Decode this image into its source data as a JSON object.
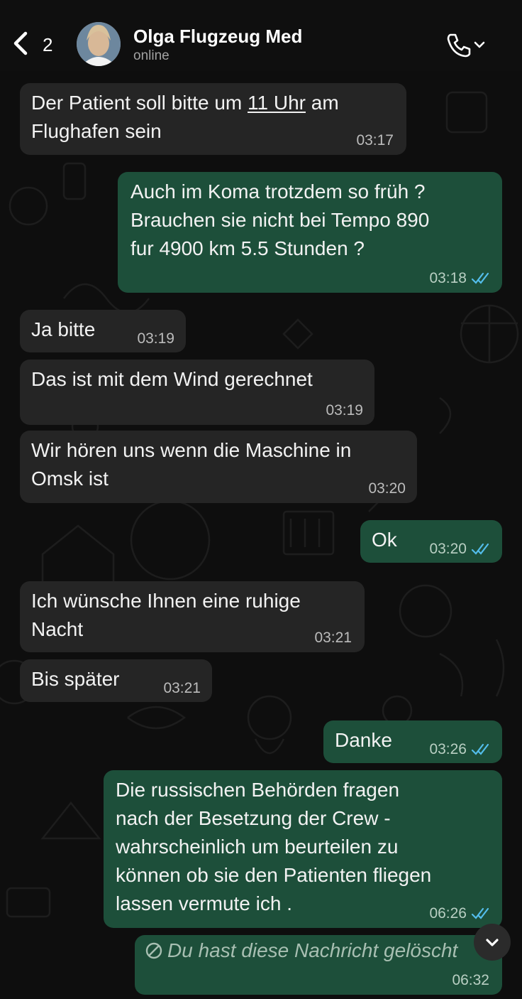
{
  "header": {
    "back_count": "2",
    "contact_name": "Olga Flugzeug Med",
    "status": "online"
  },
  "colors": {
    "incoming_bubble": "#252525",
    "outgoing_bubble": "#1d4f3a",
    "read_ticks": "#53bdeb"
  },
  "icons": {
    "back": "chevron-left-icon",
    "call": "phone-icon",
    "call_menu": "chevron-down-icon",
    "read": "double-check-icon",
    "deleted": "ban-icon",
    "scroll": "chevron-down-icon"
  },
  "messages": [
    {
      "direction": "in",
      "lines": [
        "Der Patient soll bitte um ",
        "11 Uhr",
        " am",
        "Flughafen sein"
      ],
      "time": "03:17"
    },
    {
      "direction": "out",
      "lines": [
        "Auch im Koma trotzdem so früh ?",
        "Brauchen sie nicht bei Tempo 890",
        "fur 4900 km 5.5 Stunden ?"
      ],
      "time": "03:18",
      "read": true
    },
    {
      "direction": "in",
      "lines": [
        "Ja bitte"
      ],
      "time": "03:19"
    },
    {
      "direction": "in",
      "lines": [
        "Das ist mit dem Wind gerechnet"
      ],
      "time": "03:19"
    },
    {
      "direction": "in",
      "lines": [
        "Wir hören uns wenn die Maschine in",
        "Omsk ist"
      ],
      "time": "03:20"
    },
    {
      "direction": "out",
      "lines": [
        "Ok"
      ],
      "time": "03:20",
      "read": true
    },
    {
      "direction": "in",
      "lines": [
        "Ich wünsche Ihnen eine ruhige",
        "Nacht"
      ],
      "time": "03:21"
    },
    {
      "direction": "in",
      "lines": [
        "Bis später"
      ],
      "time": "03:21"
    },
    {
      "direction": "out",
      "lines": [
        "Danke"
      ],
      "time": "03:26",
      "read": true
    },
    {
      "direction": "out",
      "lines": [
        "Die russischen Behörden fragen",
        "nach der Besetzung der Crew -",
        "wahrscheinlich um beurteilen zu",
        "können ob sie den Patienten fliegen",
        "lassen vermute ich ."
      ],
      "time": "06:26",
      "read": true
    },
    {
      "direction": "out",
      "lines": [
        "Du hast diese Nachricht gelöscht"
      ],
      "time": "06:32",
      "deleted": true
    }
  ]
}
